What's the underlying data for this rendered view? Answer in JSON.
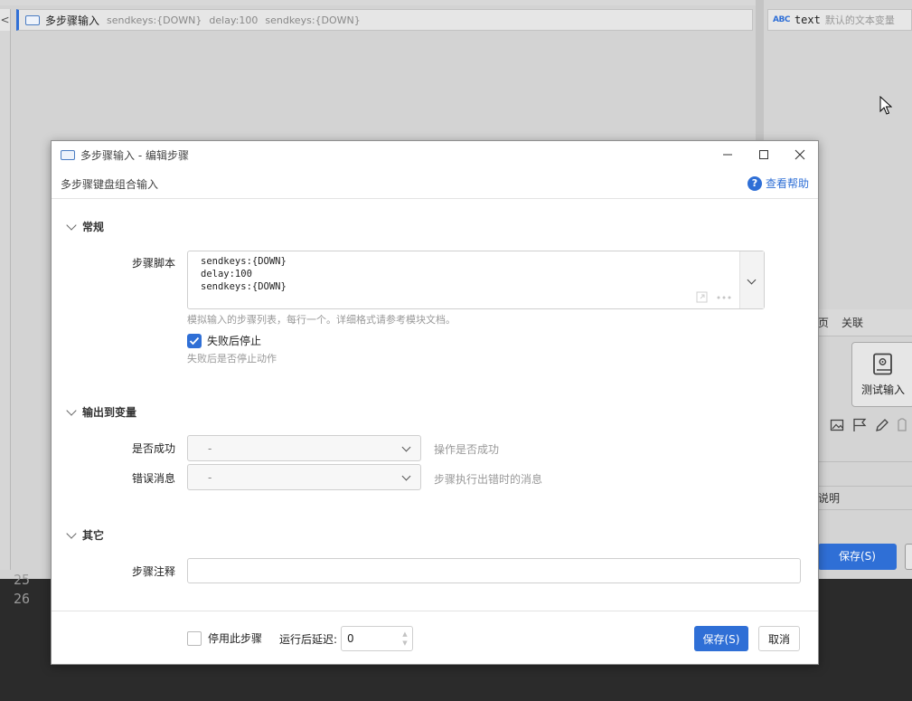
{
  "background": {
    "step_row": {
      "name": "多步骤输入",
      "details": [
        "sendkeys:{DOWN}",
        "delay:100",
        "sendkeys:{DOWN}"
      ]
    },
    "variable": {
      "type_badge": "ABC",
      "name": "text",
      "description": "默认的文本变量"
    },
    "right_panel": {
      "tabs": [
        "页",
        "关联"
      ],
      "card_label": "测试输入",
      "desc_label": "说明",
      "save_label": "保存(S)"
    },
    "editor_lines": [
      "25",
      "26"
    ]
  },
  "dialog": {
    "title": "多步骤输入 - 编辑步骤",
    "subtitle": "多步骤键盘组合输入",
    "help_label": "查看帮助",
    "sections": {
      "general": {
        "header": "常规",
        "script_label": "步骤脚本",
        "script_value": "sendkeys:{DOWN}\ndelay:100\nsendkeys:{DOWN}",
        "script_hint": "模拟输入的步骤列表，每行一个。详细格式请参考模块文档。",
        "stop_on_fail_label": "失败后停止",
        "stop_on_fail_checked": true,
        "stop_on_fail_hint": "失败后是否停止动作"
      },
      "output": {
        "header": "输出到变量",
        "success_label": "是否成功",
        "success_value": "-",
        "success_hint": "操作是否成功",
        "error_label": "错误消息",
        "error_value": "-",
        "error_hint": "步骤执行出错时的消息"
      },
      "other": {
        "header": "其它",
        "note_label": "步骤注释",
        "note_value": ""
      }
    },
    "footer": {
      "disable_label": "停用此步骤",
      "disable_checked": false,
      "delay_label": "运行后延迟:",
      "delay_value": "0",
      "save_label": "保存(S)",
      "cancel_label": "取消"
    }
  },
  "colors": {
    "accent": "#2f6fd6",
    "dialog_bg": "#ffffff",
    "backdrop": "#c9c9c9",
    "editor_bg": "#2b2b2b"
  }
}
